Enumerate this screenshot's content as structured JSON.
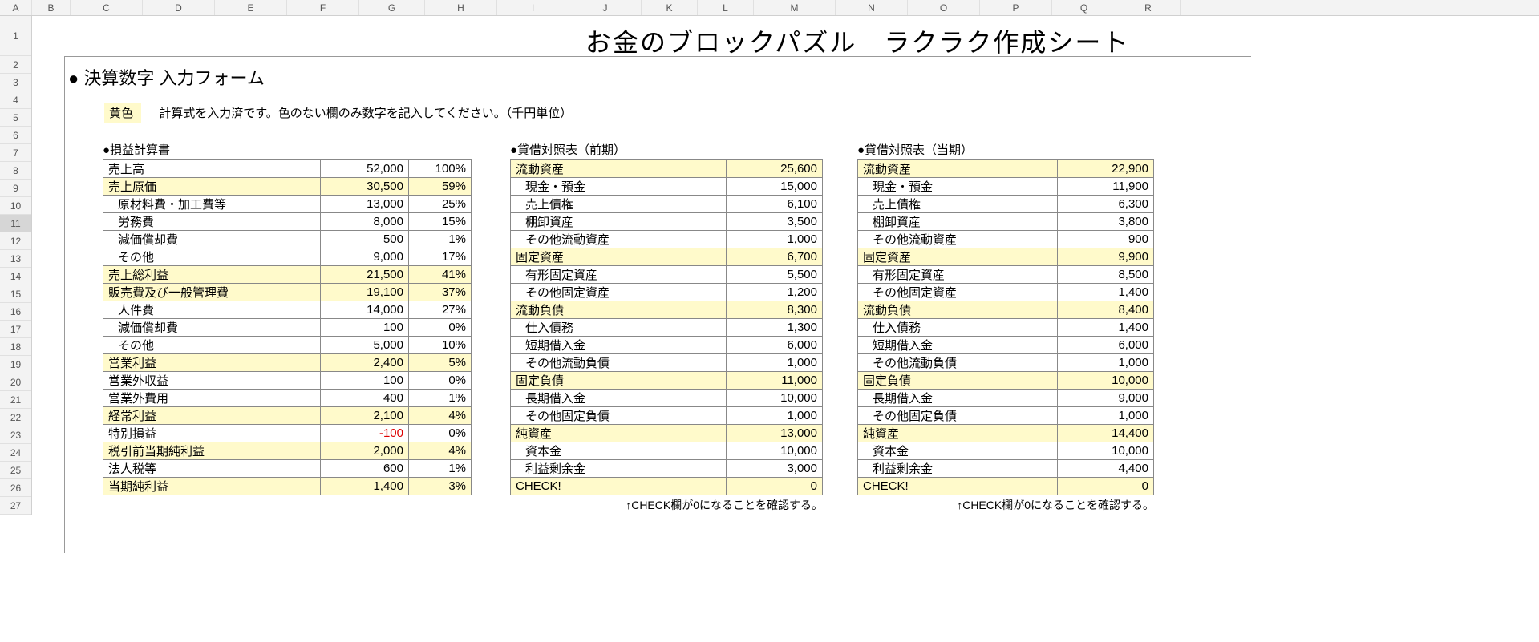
{
  "cols": [
    "A",
    "B",
    "C",
    "D",
    "E",
    "F",
    "G",
    "H",
    "I",
    "J",
    "K",
    "L",
    "M",
    "N",
    "O",
    "P",
    "Q",
    "R"
  ],
  "rows": [
    "1",
    "2",
    "3",
    "4",
    "5",
    "6",
    "7",
    "8",
    "9",
    "10",
    "11",
    "12",
    "13",
    "14",
    "15",
    "16",
    "17",
    "18",
    "19",
    "20",
    "21",
    "22",
    "23",
    "24",
    "25",
    "26",
    "27"
  ],
  "selected_row": "11",
  "title": "お金のブロックパズル　ラクラク作成シート",
  "section_heading": "● 決算数字 入力フォーム",
  "note_chip": "黄色",
  "note_text": "計算式を入力済です。色のない欄のみ数字を記入してください。（千円単位）",
  "pl": {
    "caption": "●損益計算書",
    "rows": [
      {
        "label": "売上高",
        "value": "52,000",
        "pct": "100%",
        "yellow": false,
        "indent": false
      },
      {
        "label": "売上原価",
        "value": "30,500",
        "pct": "59%",
        "yellow": true,
        "indent": false
      },
      {
        "label": "原材料費・加工費等",
        "value": "13,000",
        "pct": "25%",
        "yellow": false,
        "indent": true
      },
      {
        "label": "労務費",
        "value": "8,000",
        "pct": "15%",
        "yellow": false,
        "indent": true
      },
      {
        "label": "減価償却費",
        "value": "500",
        "pct": "1%",
        "yellow": false,
        "indent": true
      },
      {
        "label": "その他",
        "value": "9,000",
        "pct": "17%",
        "yellow": false,
        "indent": true
      },
      {
        "label": "売上総利益",
        "value": "21,500",
        "pct": "41%",
        "yellow": true,
        "indent": false
      },
      {
        "label": "販売費及び一般管理費",
        "value": "19,100",
        "pct": "37%",
        "yellow": true,
        "indent": false
      },
      {
        "label": "人件費",
        "value": "14,000",
        "pct": "27%",
        "yellow": false,
        "indent": true
      },
      {
        "label": "減価償却費",
        "value": "100",
        "pct": "0%",
        "yellow": false,
        "indent": true
      },
      {
        "label": "その他",
        "value": "5,000",
        "pct": "10%",
        "yellow": false,
        "indent": true
      },
      {
        "label": "営業利益",
        "value": "2,400",
        "pct": "5%",
        "yellow": true,
        "indent": false
      },
      {
        "label": "営業外収益",
        "value": "100",
        "pct": "0%",
        "yellow": false,
        "indent": false
      },
      {
        "label": "営業外費用",
        "value": "400",
        "pct": "1%",
        "yellow": false,
        "indent": false
      },
      {
        "label": "経常利益",
        "value": "2,100",
        "pct": "4%",
        "yellow": true,
        "indent": false
      },
      {
        "label": "特別損益",
        "value": "-100",
        "pct": "0%",
        "yellow": false,
        "indent": false,
        "neg": true
      },
      {
        "label": "税引前当期純利益",
        "value": "2,000",
        "pct": "4%",
        "yellow": true,
        "indent": false
      },
      {
        "label": "法人税等",
        "value": "600",
        "pct": "1%",
        "yellow": false,
        "indent": false
      },
      {
        "label": "当期純利益",
        "value": "1,400",
        "pct": "3%",
        "yellow": true,
        "indent": false
      }
    ]
  },
  "bs_prev": {
    "caption": "●貸借対照表（前期）",
    "footnote": "↑CHECK欄が0になることを確認する。",
    "rows": [
      {
        "label": "流動資産",
        "value": "25,600",
        "yellow": true,
        "indent": false
      },
      {
        "label": "現金・預金",
        "value": "15,000",
        "yellow": false,
        "indent": true
      },
      {
        "label": "売上債権",
        "value": "6,100",
        "yellow": false,
        "indent": true
      },
      {
        "label": "棚卸資産",
        "value": "3,500",
        "yellow": false,
        "indent": true
      },
      {
        "label": "その他流動資産",
        "value": "1,000",
        "yellow": false,
        "indent": true
      },
      {
        "label": "固定資産",
        "value": "6,700",
        "yellow": true,
        "indent": false
      },
      {
        "label": "有形固定資産",
        "value": "5,500",
        "yellow": false,
        "indent": true
      },
      {
        "label": "その他固定資産",
        "value": "1,200",
        "yellow": false,
        "indent": true
      },
      {
        "label": "流動負債",
        "value": "8,300",
        "yellow": true,
        "indent": false
      },
      {
        "label": "仕入債務",
        "value": "1,300",
        "yellow": false,
        "indent": true
      },
      {
        "label": "短期借入金",
        "value": "6,000",
        "yellow": false,
        "indent": true
      },
      {
        "label": "その他流動負債",
        "value": "1,000",
        "yellow": false,
        "indent": true
      },
      {
        "label": "固定負債",
        "value": "11,000",
        "yellow": true,
        "indent": false
      },
      {
        "label": "長期借入金",
        "value": "10,000",
        "yellow": false,
        "indent": true
      },
      {
        "label": "その他固定負債",
        "value": "1,000",
        "yellow": false,
        "indent": true
      },
      {
        "label": "純資産",
        "value": "13,000",
        "yellow": true,
        "indent": false
      },
      {
        "label": "資本金",
        "value": "10,000",
        "yellow": false,
        "indent": true
      },
      {
        "label": "利益剰余金",
        "value": "3,000",
        "yellow": false,
        "indent": true
      },
      {
        "label": "CHECK!",
        "value": "0",
        "yellow": true,
        "indent": false
      }
    ]
  },
  "bs_curr": {
    "caption": "●貸借対照表（当期）",
    "footnote": "↑CHECK欄が0になることを確認する。",
    "rows": [
      {
        "label": "流動資産",
        "value": "22,900",
        "yellow": true,
        "indent": false
      },
      {
        "label": "現金・預金",
        "value": "11,900",
        "yellow": false,
        "indent": true
      },
      {
        "label": "売上債権",
        "value": "6,300",
        "yellow": false,
        "indent": true
      },
      {
        "label": "棚卸資産",
        "value": "3,800",
        "yellow": false,
        "indent": true
      },
      {
        "label": "その他流動資産",
        "value": "900",
        "yellow": false,
        "indent": true
      },
      {
        "label": "固定資産",
        "value": "9,900",
        "yellow": true,
        "indent": false
      },
      {
        "label": "有形固定資産",
        "value": "8,500",
        "yellow": false,
        "indent": true
      },
      {
        "label": "その他固定資産",
        "value": "1,400",
        "yellow": false,
        "indent": true
      },
      {
        "label": "流動負債",
        "value": "8,400",
        "yellow": true,
        "indent": false
      },
      {
        "label": "仕入債務",
        "value": "1,400",
        "yellow": false,
        "indent": true
      },
      {
        "label": "短期借入金",
        "value": "6,000",
        "yellow": false,
        "indent": true
      },
      {
        "label": "その他流動負債",
        "value": "1,000",
        "yellow": false,
        "indent": true
      },
      {
        "label": "固定負債",
        "value": "10,000",
        "yellow": true,
        "indent": false
      },
      {
        "label": "長期借入金",
        "value": "9,000",
        "yellow": false,
        "indent": true
      },
      {
        "label": "その他固定負債",
        "value": "1,000",
        "yellow": false,
        "indent": true
      },
      {
        "label": "純資産",
        "value": "14,400",
        "yellow": true,
        "indent": false
      },
      {
        "label": "資本金",
        "value": "10,000",
        "yellow": false,
        "indent": true
      },
      {
        "label": "利益剰余金",
        "value": "4,400",
        "yellow": false,
        "indent": true
      },
      {
        "label": "CHECK!",
        "value": "0",
        "yellow": true,
        "indent": false
      }
    ]
  }
}
